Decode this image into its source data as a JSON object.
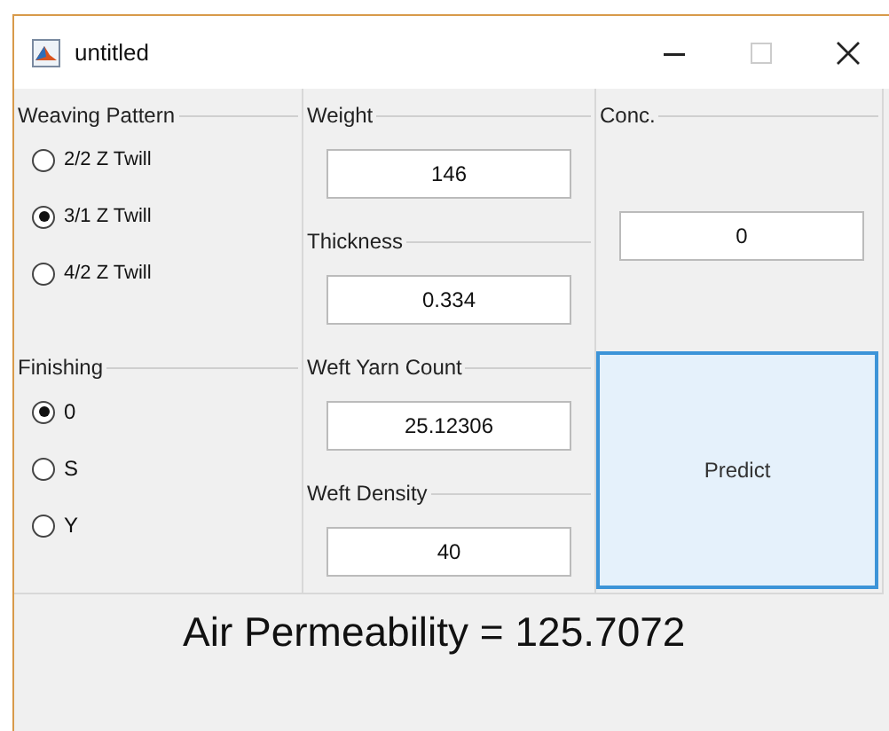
{
  "window": {
    "title": "untitled"
  },
  "weaving_pattern": {
    "title": "Weaving Pattern",
    "options": [
      {
        "label": "2/2 Z Twill",
        "selected": false
      },
      {
        "label": "3/1 Z Twill",
        "selected": true
      },
      {
        "label": "4/2 Z Twill",
        "selected": false
      }
    ]
  },
  "finishing": {
    "title": "Finishing",
    "options": [
      {
        "label": "0",
        "selected": true
      },
      {
        "label": "S",
        "selected": false
      },
      {
        "label": "Y",
        "selected": false
      }
    ]
  },
  "fields": [
    {
      "label": "Weight",
      "value": "146"
    },
    {
      "label": "Thickness",
      "value": "0.334"
    },
    {
      "label": "Weft Yarn Count",
      "value": "25.12306"
    },
    {
      "label": "Weft Density",
      "value": "40"
    }
  ],
  "conc": {
    "label": "Conc.",
    "value": "0"
  },
  "predict_button": "Predict",
  "result": "Air Permeability = 125.7072"
}
